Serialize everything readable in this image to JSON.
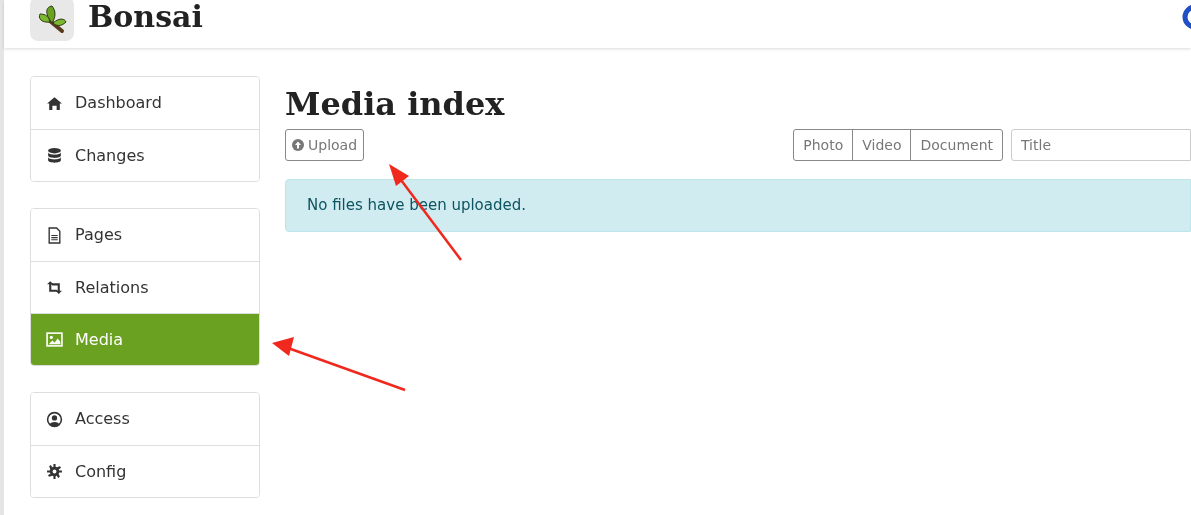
{
  "header": {
    "title": "Bonsai"
  },
  "sidebar": {
    "groups": [
      {
        "items": [
          {
            "label": "Dashboard",
            "selected": false
          },
          {
            "label": "Changes",
            "selected": false
          }
        ]
      },
      {
        "items": [
          {
            "label": "Pages",
            "selected": false
          },
          {
            "label": "Relations",
            "selected": false
          },
          {
            "label": "Media",
            "selected": true
          }
        ]
      },
      {
        "items": [
          {
            "label": "Access",
            "selected": false
          },
          {
            "label": "Config",
            "selected": false
          }
        ]
      }
    ]
  },
  "main": {
    "title": "Media index",
    "upload_button": "Upload",
    "filters": [
      "Photo",
      "Video",
      "Document"
    ],
    "search": {
      "placeholder": "Title"
    },
    "alert": "No files have been uploaded."
  }
}
